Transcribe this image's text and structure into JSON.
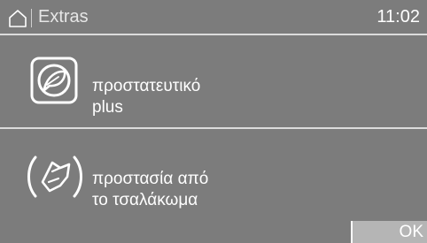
{
  "header": {
    "home_icon": "home-icon",
    "title": "Extras",
    "time": "11:02"
  },
  "items": [
    {
      "icon": "feather-protection-icon",
      "label_line1": "προστατευτικό",
      "label_line2": "plus"
    },
    {
      "icon": "crease-protection-icon",
      "label_line1": "προστασία από",
      "label_line2": "το τσαλάκωμα"
    }
  ],
  "footer": {
    "ok_label": "OK"
  },
  "colors": {
    "panel": "#7c7c7c",
    "separator": "#dcdcdc",
    "ok_button": "#b5b5b5",
    "text": "#ffffff"
  }
}
